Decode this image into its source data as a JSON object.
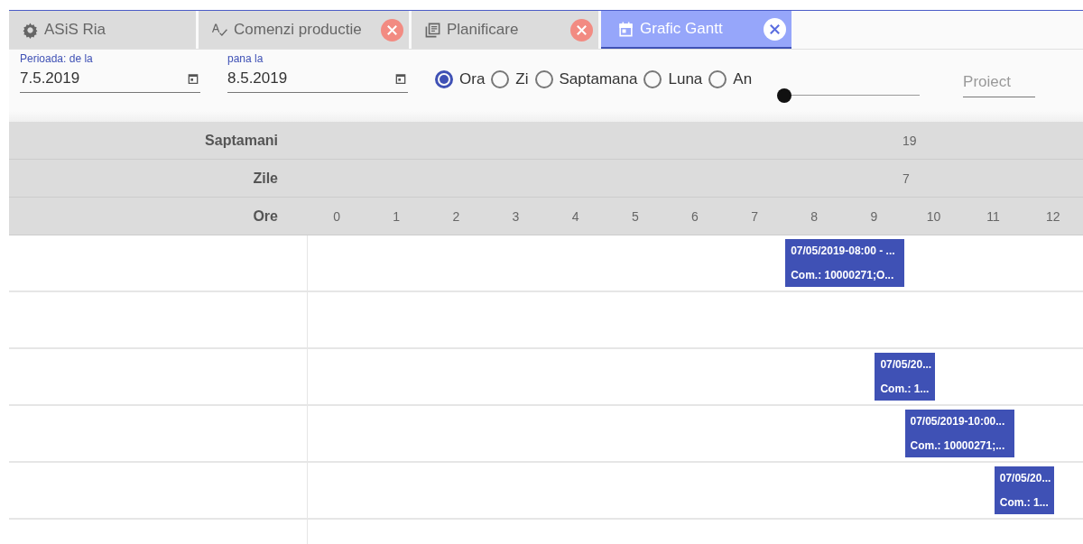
{
  "tabs": [
    {
      "label": "ASiS Ria",
      "kind": "gear",
      "closable": false,
      "selected": false
    },
    {
      "label": "Comenzi productie",
      "kind": "spellcheck",
      "closable": true,
      "selected": false
    },
    {
      "label": "Planificare",
      "kind": "list",
      "closable": true,
      "selected": false
    },
    {
      "label": "Grafic Gantt",
      "kind": "calendar",
      "closable": true,
      "selected": true
    }
  ],
  "period": {
    "from": {
      "label": "Perioada: de la",
      "value": "7.5.2019"
    },
    "to": {
      "label": "pana la",
      "value": "8.5.2019"
    }
  },
  "scale": [
    {
      "label": "Ora",
      "selected": true
    },
    {
      "label": "Zi",
      "selected": false
    },
    {
      "label": "Saptamana",
      "selected": false
    },
    {
      "label": "Luna",
      "selected": false
    },
    {
      "label": "An",
      "selected": false
    }
  ],
  "zoom_slider": {
    "level": 0
  },
  "project_field": {
    "placeholder": "Proiect"
  },
  "gantt": {
    "header_rows": [
      {
        "label": "Saptamani",
        "values": [
          "19"
        ]
      },
      {
        "label": "Zile",
        "values": [
          "7"
        ]
      },
      {
        "label": "Ore",
        "values": [
          "0",
          "1",
          "2",
          "3",
          "4",
          "5",
          "6",
          "7",
          "8",
          "9",
          "10",
          "11",
          "12"
        ]
      }
    ],
    "rows": [
      {
        "tasks": [
          {
            "line_1": "07/05/2019-08:00 - ...",
            "line_2": "Com.: 10000271;O..."
          }
        ]
      },
      {
        "tasks": []
      },
      {
        "tasks": [
          {
            "line_1": "07/05/20...",
            "line_2": "Com.: 1..."
          }
        ]
      },
      {
        "tasks": [
          {
            "line_1": "07/05/2019-10:00...",
            "line_2": "Com.: 10000271;..."
          }
        ]
      },
      {
        "tasks": [
          {
            "line_1": "07/05/20...",
            "line_2": "Com.: 1..."
          }
        ]
      },
      {
        "tasks": []
      }
    ]
  }
}
